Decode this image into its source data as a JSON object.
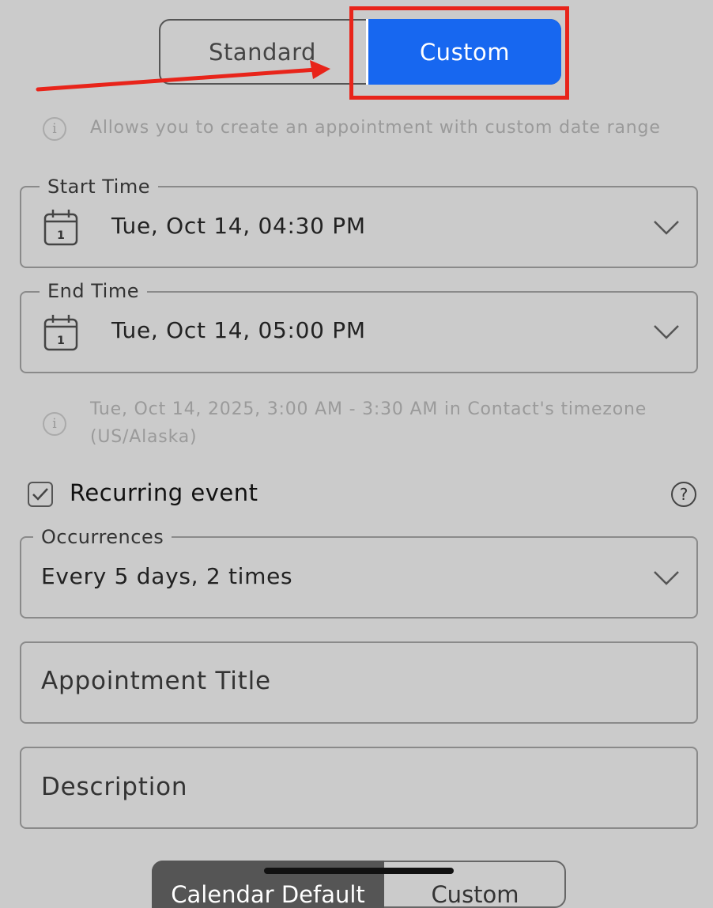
{
  "mode_toggle": {
    "standard_label": "Standard",
    "custom_label": "Custom",
    "selected": "Custom",
    "accent_color": "#1767f0"
  },
  "custom_hint": "Allows you to create an appointment with custom date range",
  "start_time": {
    "label": "Start Time",
    "value": "Tue, Oct 14, 04:30 PM",
    "calendar_day": "1"
  },
  "end_time": {
    "label": "End Time",
    "value": "Tue, Oct 14, 05:00 PM",
    "calendar_day": "1"
  },
  "timezone_hint": {
    "line1": "Tue, Oct 14, 2025, 3:00 AM - 3:30 AM in Contact's timezone",
    "line2": "(US/Alaska)"
  },
  "recurring": {
    "label": "Recurring event",
    "checked": true
  },
  "occurrences": {
    "label": "Occurrences",
    "value": "Every 5 days, 2 times"
  },
  "appointment_title": {
    "placeholder": "Appointment Title"
  },
  "description": {
    "placeholder": "Description"
  },
  "bottom_toggle": {
    "left_label": "Calendar Default",
    "right_label": "Custom"
  },
  "annotation": {
    "arrow_color": "#e8241a",
    "highlight_color": "#e8241a"
  }
}
